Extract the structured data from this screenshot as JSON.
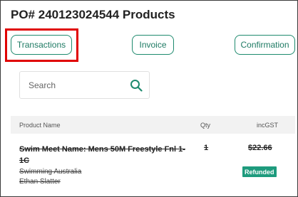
{
  "page": {
    "title": "PO# 240123024544 Products"
  },
  "buttons": {
    "transactions": "Transactions",
    "invoice": "Invoice",
    "confirmation": "Confirmation"
  },
  "search": {
    "placeholder": "Search",
    "value": ""
  },
  "table": {
    "headers": {
      "product": "Product  Name",
      "qty": "Qty",
      "incgst": "incGST"
    },
    "rows": [
      {
        "product_name": "Swim Meet Name: Mens 50M Freestyle Fnl 1-1C",
        "organisation": "Swimming Australia",
        "person": "Ethan Slatter",
        "qty": "1",
        "price": "$22.66",
        "status": "Refunded"
      }
    ]
  },
  "colors": {
    "accent": "#1e8a6e",
    "highlight": "#e00000",
    "badge": "#1e9b7d"
  }
}
